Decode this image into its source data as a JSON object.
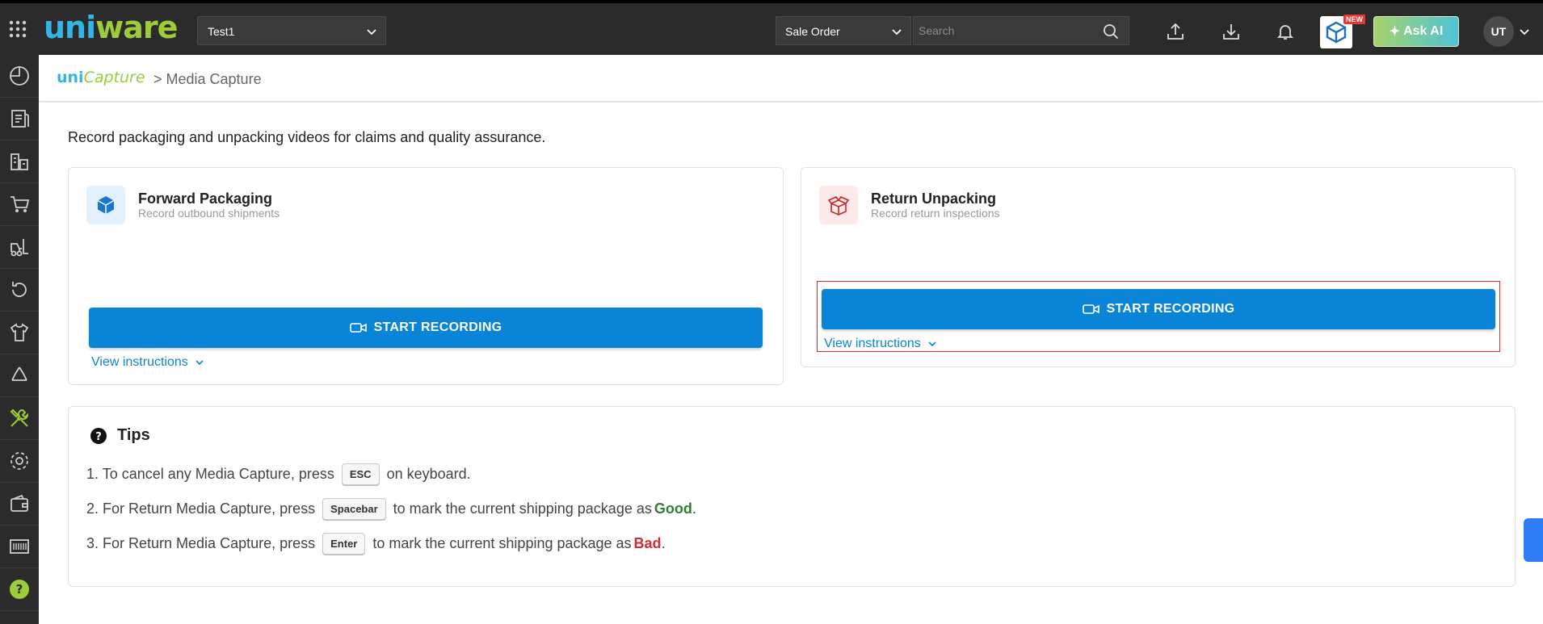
{
  "topbar": {
    "tenant": "Test1",
    "order_type": "Sale Order",
    "search_placeholder": "Search",
    "new_badge": "NEW",
    "ask_ai_label": "Ask AI",
    "user_initials": "UT"
  },
  "logo": {
    "part1": "uni",
    "part2": "ware"
  },
  "breadcrumb": {
    "logo_part1": "uni",
    "logo_part2": "Capture",
    "page": "> Media Capture"
  },
  "intro": "Record packaging and unpacking videos for claims and quality assurance.",
  "cards": {
    "forward": {
      "title": "Forward Packaging",
      "subtitle": "Record outbound shipments",
      "button": "START RECORDING",
      "link": "View instructions"
    },
    "return": {
      "title": "Return Unpacking",
      "subtitle": "Record return inspections",
      "button": "START RECORDING",
      "link": "View instructions"
    }
  },
  "tips": {
    "title": "Tips",
    "t1_a": "1. To cancel any Media Capture, press",
    "t1_key": "ESC",
    "t1_b": "on keyboard.",
    "t2_a": "2. For Return Media Capture, press",
    "t2_key": "Spacebar",
    "t2_b": "to mark the current shipping package as",
    "t2_status": "Good",
    "t3_a": "3. For Return Media Capture, press",
    "t3_key": "Enter",
    "t3_b": "to mark the current shipping package as",
    "t3_status": "Bad",
    "period": "."
  },
  "sidebar_icons": [
    "dashboard-icon",
    "orders-icon",
    "warehouse-icon",
    "cart-icon",
    "forklift-icon",
    "returns-icon",
    "apparel-icon",
    "recycle-icon",
    "tools-icon",
    "settings-icon",
    "wallet-icon",
    "barcode-icon",
    "help-icon"
  ],
  "colors": {
    "primary": "#0a84d6",
    "topbar": "#2b2b2b",
    "good": "#2e7d32",
    "bad": "#d32f2f"
  }
}
